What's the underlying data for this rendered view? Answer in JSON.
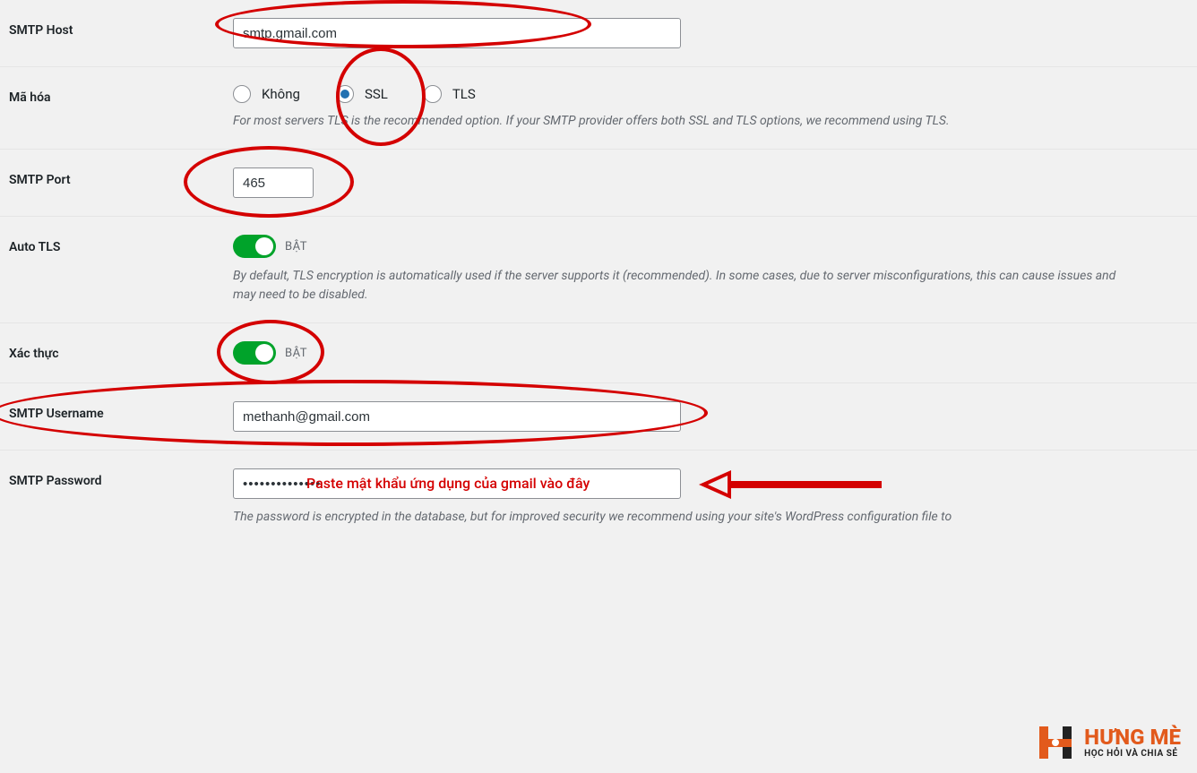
{
  "smtp_host": {
    "label": "SMTP Host",
    "value": "smtp.gmail.com"
  },
  "encryption": {
    "label": "Mã hóa",
    "options": {
      "none": "Không",
      "ssl": "SSL",
      "tls": "TLS"
    },
    "selected": "ssl",
    "desc": "For most servers TLS is the recommended option. If your SMTP provider offers both SSL and TLS options, we recommend using TLS."
  },
  "smtp_port": {
    "label": "SMTP Port",
    "value": "465"
  },
  "auto_tls": {
    "label": "Auto TLS",
    "state_label": "BẬT",
    "desc": "By default, TLS encryption is automatically used if the server supports it (recommended). In some cases, due to server misconfigurations, this can cause issues and may need to be disabled."
  },
  "auth": {
    "label": "Xác thực",
    "state_label": "BẬT"
  },
  "smtp_user": {
    "label": "SMTP Username",
    "value": "methanh@gmail.com"
  },
  "smtp_pass": {
    "label": "SMTP Password",
    "value": "••••••••••••••",
    "annotation": "Paste mật khẩu ứng dụng của gmail vào đây",
    "desc": "The password is encrypted in the database, but for improved security we recommend using your site's WordPress configuration file to"
  },
  "brand": {
    "title": "HƯNG MÈ",
    "subtitle": "HỌC HỎI VÀ CHIA SẺ"
  }
}
